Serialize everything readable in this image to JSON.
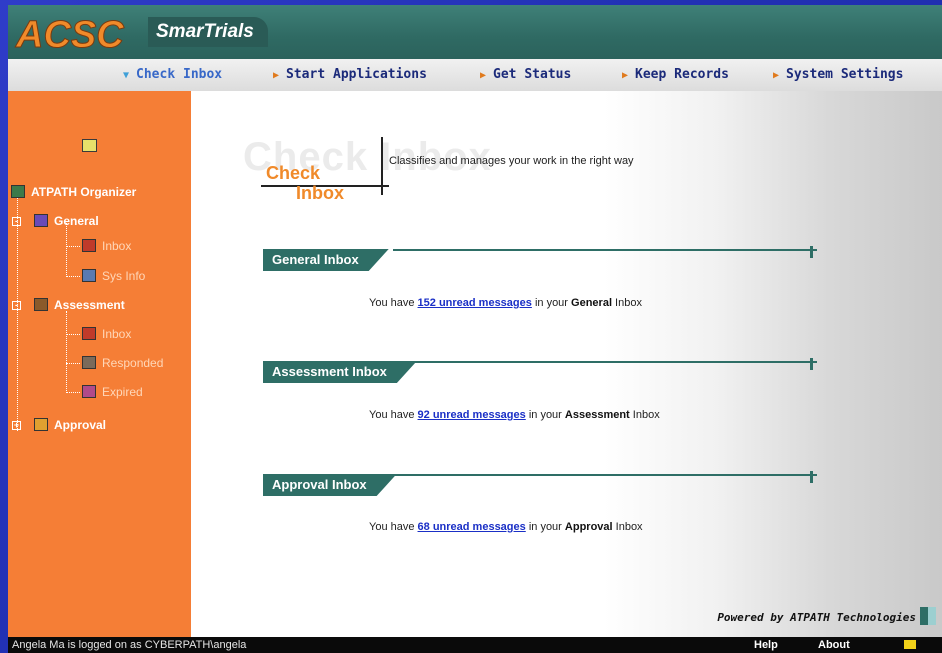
{
  "header": {
    "logo_text": "ACSC",
    "brand": "SmarTrials"
  },
  "menu": [
    {
      "label": "Check Inbox",
      "active": true
    },
    {
      "label": "Start Applications",
      "active": false
    },
    {
      "label": "Get Status",
      "active": false
    },
    {
      "label": "Keep Records",
      "active": false
    },
    {
      "label": "System Settings",
      "active": false
    }
  ],
  "sidebar": {
    "root": "ATPATH Organizer",
    "groups": [
      {
        "label": "General",
        "items": [
          "Inbox",
          "Sys Info"
        ]
      },
      {
        "label": "Assessment",
        "items": [
          "Inbox",
          "Responded",
          "Expired"
        ]
      },
      {
        "label": "Approval",
        "items": []
      }
    ]
  },
  "page": {
    "ghost_title": "Check Inbox",
    "title_line1": "Check",
    "title_line2": "Inbox",
    "description": "Classifies and manages your work in the right way"
  },
  "sections": [
    {
      "title": "General Inbox",
      "prefix": "You have ",
      "link": "152 unread messages",
      "mid": " in your ",
      "box": "General",
      "suffix": " Inbox"
    },
    {
      "title": "Assessment Inbox",
      "prefix": "You have ",
      "link": "92 unread messages",
      "mid": " in your ",
      "box": "Assessment",
      "suffix": " Inbox"
    },
    {
      "title": "Approval Inbox",
      "prefix": "You have ",
      "link": "68 unread messages",
      "mid": " in your ",
      "box": "Approval",
      "suffix": " Inbox"
    }
  ],
  "footer": {
    "powered_by": "Powered by ATPATH Technologies",
    "status": "Angela Ma is logged on as CYBERPATH\\angela",
    "help": "Help",
    "about": "About"
  },
  "colors": {
    "sidebar": "#f57e36",
    "header": "#2f6a63",
    "accent": "#f08a2a",
    "link": "#1a2fc6"
  }
}
